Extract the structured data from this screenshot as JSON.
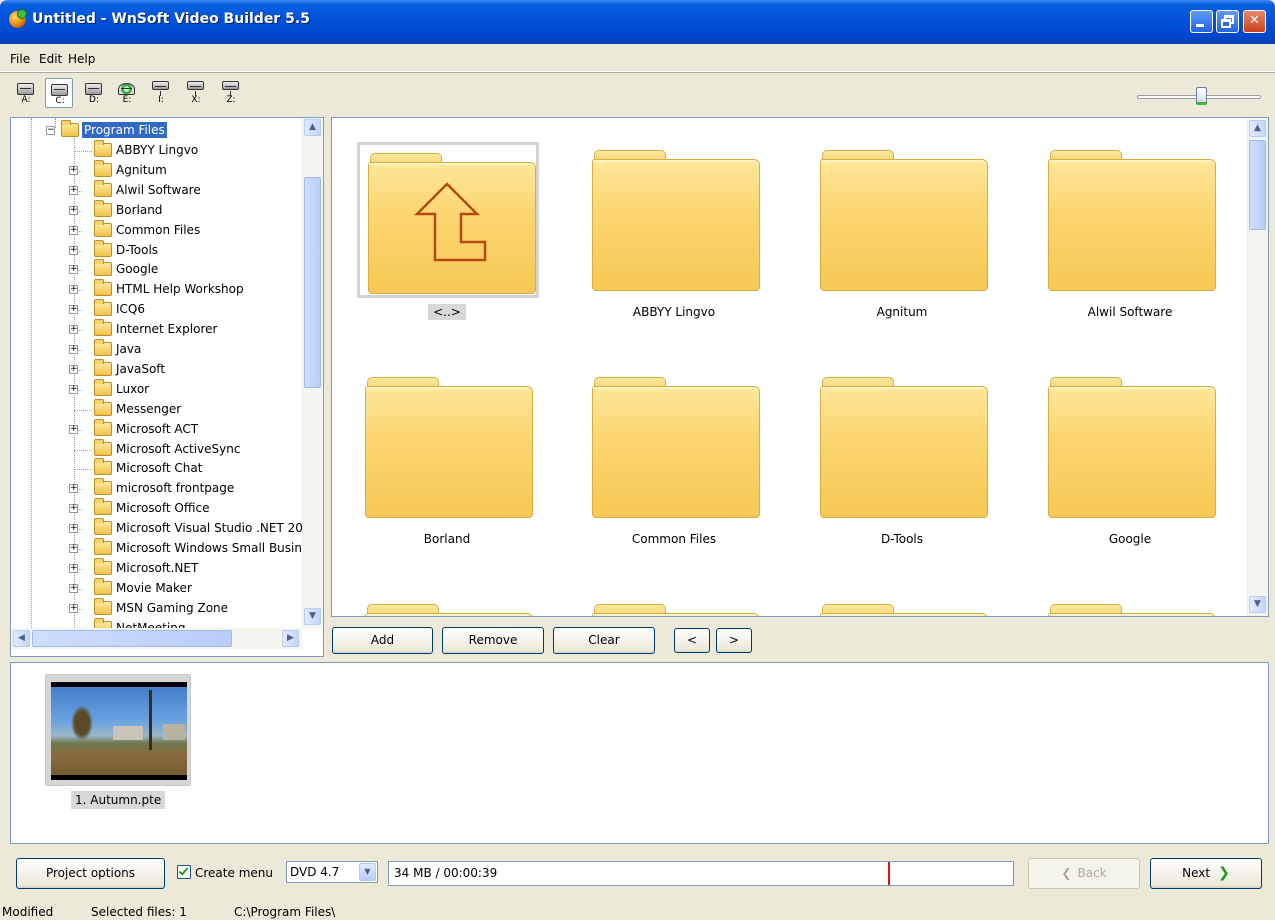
{
  "window": {
    "title": "Untitled - WnSoft Video Builder 5.5"
  },
  "menu": [
    "File",
    "Edit",
    "Help"
  ],
  "drives": [
    "A:",
    "C:",
    "D:",
    "E:",
    "I:",
    "X:",
    "Z:"
  ],
  "selected_drive": "C:",
  "zoom_slider": {
    "value": 0.52
  },
  "tree": {
    "selected": "Program Files",
    "items": [
      {
        "label": "ABBYY Lingvo",
        "expandable": false
      },
      {
        "label": "Agnitum",
        "expandable": true
      },
      {
        "label": "Alwil Software",
        "expandable": true
      },
      {
        "label": "Borland",
        "expandable": true
      },
      {
        "label": "Common Files",
        "expandable": true
      },
      {
        "label": "D-Tools",
        "expandable": true
      },
      {
        "label": "Google",
        "expandable": true
      },
      {
        "label": "HTML Help Workshop",
        "expandable": true
      },
      {
        "label": "ICQ6",
        "expandable": true
      },
      {
        "label": "Internet Explorer",
        "expandable": true
      },
      {
        "label": "Java",
        "expandable": true
      },
      {
        "label": "JavaSoft",
        "expandable": true
      },
      {
        "label": "Luxor",
        "expandable": true
      },
      {
        "label": "Messenger",
        "expandable": false
      },
      {
        "label": "Microsoft ACT",
        "expandable": true
      },
      {
        "label": "Microsoft ActiveSync",
        "expandable": false
      },
      {
        "label": "Microsoft Chat",
        "expandable": false
      },
      {
        "label": "microsoft frontpage",
        "expandable": true
      },
      {
        "label": "Microsoft Office",
        "expandable": true
      },
      {
        "label": "Microsoft Visual Studio .NET 20",
        "expandable": true
      },
      {
        "label": "Microsoft Windows Small Busine",
        "expandable": true
      },
      {
        "label": "Microsoft.NET",
        "expandable": true
      },
      {
        "label": "Movie Maker",
        "expandable": true
      },
      {
        "label": "MSN Gaming Zone",
        "expandable": true
      },
      {
        "label": "NetMeeting",
        "expandable": false
      }
    ]
  },
  "files": [
    {
      "label": "<..>",
      "up": true
    },
    {
      "label": "ABBYY Lingvo"
    },
    {
      "label": "Agnitum"
    },
    {
      "label": "Alwil Software"
    },
    {
      "label": "Borland"
    },
    {
      "label": "Common Files"
    },
    {
      "label": "D-Tools"
    },
    {
      "label": "Google"
    }
  ],
  "file_buttons": {
    "add": "Add",
    "remove": "Remove",
    "clear": "Clear",
    "prev": "<",
    "next": ">"
  },
  "filmstrip": [
    {
      "caption": "1. Autumn.pte"
    }
  ],
  "bottom": {
    "project_options": "Project options",
    "create_menu_label": "Create menu",
    "create_menu_checked": true,
    "disc_type": "DVD 4.7",
    "size_text": "34 MB / 00:00:39",
    "back": "Back",
    "next": "Next"
  },
  "status": {
    "state": "Modified",
    "selected": "Selected files: 1",
    "path": "C:\\Program Files\\"
  },
  "colors": {
    "title_bar": "#0050d8",
    "selection": "#316ac5",
    "folder": "#f8d066",
    "size_marker": "#e01010",
    "next_arrow": "#1a9a1a"
  }
}
